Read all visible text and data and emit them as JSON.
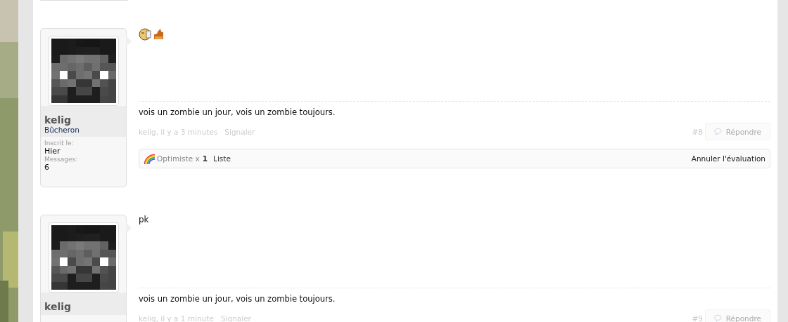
{
  "posts": [
    {
      "user": {
        "name": "kelig",
        "rank": "Bûcheron",
        "stats": [
          {
            "label": "Inscrit le:",
            "value": "Hier"
          },
          {
            "label": "Messages:",
            "value": "6"
          }
        ]
      },
      "body": {
        "kind": "smilies"
      },
      "signature": "vois un zombie un jour, vois un zombie toujours.",
      "meta": {
        "author_time": "kelig, il y a 3 minutes",
        "report": "Signaler",
        "number": "#8",
        "reply": "Répondre"
      },
      "rating": {
        "name": "Optimiste",
        "times": "x",
        "count": "1",
        "list": "Liste",
        "cancel": "Annuler l'évaluation"
      }
    },
    {
      "user": {
        "name": "kelig"
      },
      "body": {
        "kind": "text",
        "text": "pk"
      },
      "signature": "vois un zombie un jour, vois un zombie toujours.",
      "meta": {
        "author_time": "kelig, il y a 1 minute",
        "report": "Signaler",
        "number": "#9",
        "reply": "Répondre"
      }
    }
  ]
}
